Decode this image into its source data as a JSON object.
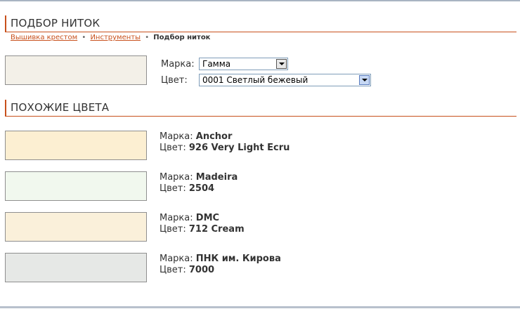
{
  "header_main": {
    "title": "ПОДБОР НИТОК"
  },
  "breadcrumb": {
    "items": [
      "Вышивка крестом",
      "Инструменты"
    ],
    "separator": "•",
    "current": "Подбор ниток"
  },
  "picker": {
    "swatch_color": "#f3f0e8",
    "brand_label": "Марка:",
    "brand_value": "Гамма",
    "color_label": "Цвет:",
    "color_value": "0001 Светлый бежевый"
  },
  "header_similar": {
    "title": "ПОХОЖИЕ ЦВЕТА"
  },
  "similar": {
    "brand_label": "Марка:",
    "color_label": "Цвет:",
    "items": [
      {
        "brand": "Anchor",
        "color": "926 Very Light Ecru",
        "swatch": "#fcefd2"
      },
      {
        "brand": "Madeira",
        "color": "2504",
        "swatch": "#f1f8ee"
      },
      {
        "brand": "DMC",
        "color": "712 Cream",
        "swatch": "#faf0da"
      },
      {
        "brand": "ПНК им. Кирова",
        "color": "7000",
        "swatch": "#e6e8e6"
      }
    ]
  },
  "colors": {
    "accent": "#c8501c",
    "select_border": "#7f9db9"
  },
  "icons": {
    "dropdown": "chevron-down-icon"
  }
}
